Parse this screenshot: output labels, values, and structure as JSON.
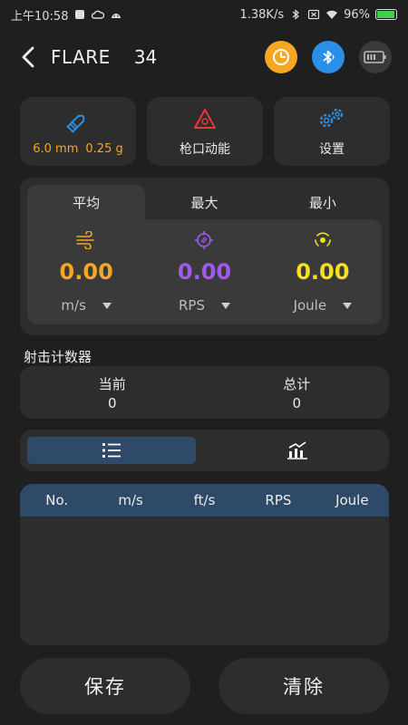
{
  "statusbar": {
    "time": "上午10:58",
    "speed": "1.38K/s",
    "battery": "96%"
  },
  "header": {
    "title": "FLARE",
    "number": "34",
    "buttons": [
      {
        "icon": "clock-icon",
        "color": "#f5a623"
      },
      {
        "icon": "bluetooth-icon",
        "color": "#2b8fe8"
      },
      {
        "icon": "battery-icon",
        "color": "#3a3a3a"
      }
    ]
  },
  "tiles": {
    "projectile": {
      "caliber": "6.0 mm",
      "weight": "0.25 g"
    },
    "energy": {
      "label": "枪口动能"
    },
    "settings": {
      "label": "设置"
    }
  },
  "stats": {
    "tabs": [
      "平均",
      "最大",
      "最小"
    ],
    "active_tab": 0,
    "columns": [
      {
        "value": "0.00",
        "unit": "m/s",
        "color": "#f5a623",
        "icon": "wind-icon"
      },
      {
        "value": "0.00",
        "unit": "RPS",
        "color": "#a259f0",
        "icon": "spin-icon"
      },
      {
        "value": "0.00",
        "unit": "Joule",
        "color": "#f4e01c",
        "icon": "impact-icon"
      }
    ]
  },
  "counter": {
    "section_label": "射击计数器",
    "current_label": "当前",
    "current_value": "0",
    "total_label": "总计",
    "total_value": "0"
  },
  "table": {
    "headers": [
      "No.",
      "m/s",
      "ft/s",
      "RPS",
      "Joule"
    ],
    "rows": []
  },
  "actions": {
    "save": "保存",
    "clear": "清除"
  },
  "colors": {
    "background": "#1f1f1f",
    "card": "#2d2d2d",
    "accent_blue": "#2f4a68",
    "orange": "#f5a623",
    "purple": "#a259f0",
    "yellow": "#f4e01c"
  }
}
